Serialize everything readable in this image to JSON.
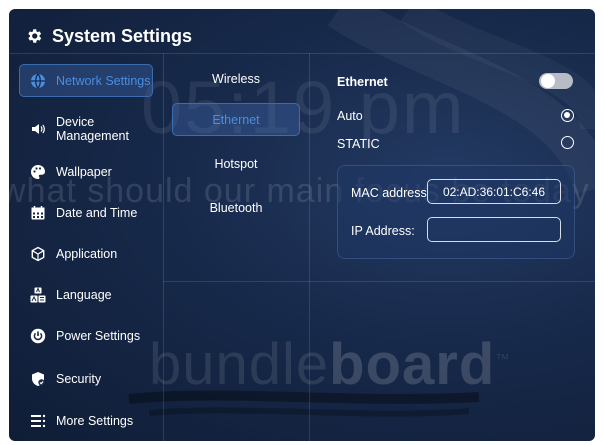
{
  "header": {
    "title": "System Settings",
    "title_icon": "gear-icon"
  },
  "background": {
    "clock": "05:19 pm",
    "question": "what should our main focus be today",
    "brand_light": "bundle",
    "brand_bold": "board",
    "brand_mark": "™"
  },
  "sidebar": {
    "items": [
      {
        "label": "Network Settings",
        "icon": "globe-icon",
        "active": true
      },
      {
        "label": "Device Management",
        "icon": "speaker-icon",
        "active": false
      },
      {
        "label": "Wallpaper",
        "icon": "palette-icon",
        "active": false
      },
      {
        "label": "Date and Time",
        "icon": "calendar-icon",
        "active": false
      },
      {
        "label": "Application",
        "icon": "hexagon-icon",
        "active": false
      },
      {
        "label": "Language",
        "icon": "language-icon",
        "active": false
      },
      {
        "label": "Power Settings",
        "icon": "power-icon",
        "active": false
      },
      {
        "label": "Security",
        "icon": "shield-icon",
        "active": false
      },
      {
        "label": "More Settings",
        "icon": "more-settings-icon",
        "active": false
      }
    ]
  },
  "network_tabs": {
    "items": [
      {
        "label": "Wireless",
        "active": false
      },
      {
        "label": "Ethernet",
        "active": true
      },
      {
        "label": "Hotspot",
        "active": false
      },
      {
        "label": "Bluetooth",
        "active": false
      }
    ]
  },
  "ethernet": {
    "heading": "Ethernet",
    "enabled": false,
    "mode_auto_label": "Auto",
    "mode_static_label": "STATIC",
    "selected_mode": "Auto",
    "mac_label": "MAC address",
    "mac_value": "02:AD:36:01:C6:46",
    "ip_label": "IP Address:",
    "ip_value": ""
  },
  "colors": {
    "accent": "#4a8ee0",
    "panel_bg": "#17294a",
    "active_bg": "#2d4a7a"
  }
}
